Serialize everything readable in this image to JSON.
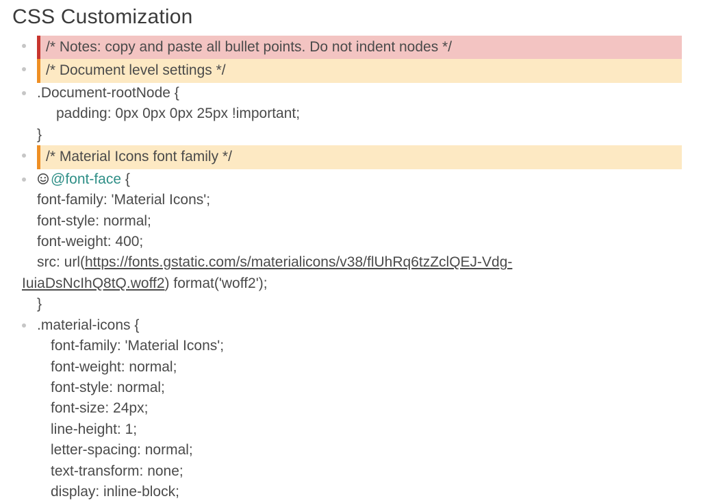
{
  "title": "CSS Customization",
  "items": [
    {
      "kind": "hl-red",
      "text": "/* Notes: copy and paste all bullet points. Do not indent nodes */"
    },
    {
      "kind": "hl-orange",
      "text": "/* Document level settings */"
    },
    {
      "kind": "code",
      "lines": [
        {
          "cls": "",
          "text": ".Document-rootNode {"
        },
        {
          "cls": "indent2",
          "text": "padding: 0px 0px 0px 25px !important;"
        },
        {
          "cls": "",
          "text": "}"
        }
      ]
    },
    {
      "kind": "hl-orange",
      "text": "/* Material Icons font family */"
    },
    {
      "kind": "font-face",
      "leading_icon": "smiley-icon",
      "at_rule": "@font-face",
      "open": " {",
      "lines_mid": [
        "font-family: 'Material Icons';",
        "font-style: normal;",
        "font-weight: 400;"
      ],
      "src_prefix": "src: url(",
      "src_url_part1": "https://fonts.gstatic.com/s/materialicons/v38/flUhRq6tzZclQEJ-Vdg-",
      "src_url_part2": "IuiaDsNcIhQ8tQ.woff2",
      "src_suffix": ") format('woff2');",
      "close": "}"
    },
    {
      "kind": "code",
      "lines": [
        {
          "cls": "",
          "text": ".material-icons {"
        },
        {
          "cls": "indent1",
          "text": "font-family: 'Material Icons';"
        },
        {
          "cls": "indent1",
          "text": "font-weight: normal;"
        },
        {
          "cls": "indent1",
          "text": "font-style: normal;"
        },
        {
          "cls": "indent1",
          "text": "font-size: 24px;"
        },
        {
          "cls": "indent1",
          "text": "line-height: 1;"
        },
        {
          "cls": "indent1",
          "text": "letter-spacing: normal;"
        },
        {
          "cls": "indent1",
          "text": "text-transform: none;"
        },
        {
          "cls": "indent1",
          "text": "display: inline-block;"
        }
      ]
    }
  ]
}
